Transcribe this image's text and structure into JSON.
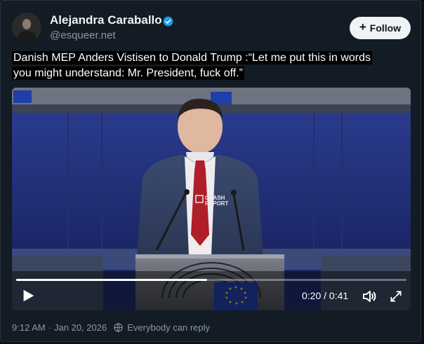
{
  "author": {
    "name": "Alejandra Caraballo",
    "handle": "@esqueer.net"
  },
  "follow_button": {
    "label": "Follow",
    "icon": "plus-icon"
  },
  "post": {
    "text_line1": "Danish MEP Anders Vistisen to Donald Trump :“Let me put this in words",
    "text_line2": "you might understand: Mr. President, fuck off.”"
  },
  "video": {
    "watermark_top": "CRASH",
    "watermark_bottom": "REPORT",
    "current_time": "0:20",
    "duration": "0:41",
    "time_display": "0:20 / 0:41",
    "progress": 0.49
  },
  "meta": {
    "timestamp": "9:12 AM",
    "date": "Jan 20, 2026",
    "separator": "·",
    "reply_setting": "Everybody can reply"
  },
  "icons": {
    "verified": "verified-badge-icon",
    "play": "play-icon",
    "volume": "volume-icon",
    "fullscreen": "expand-icon",
    "reply": "globe-reply-icon"
  },
  "colors": {
    "background": "#131b24",
    "verified_blue": "#1d9bf0",
    "muted_text": "#8b98a5",
    "follow_bg": "#eff3f4"
  }
}
